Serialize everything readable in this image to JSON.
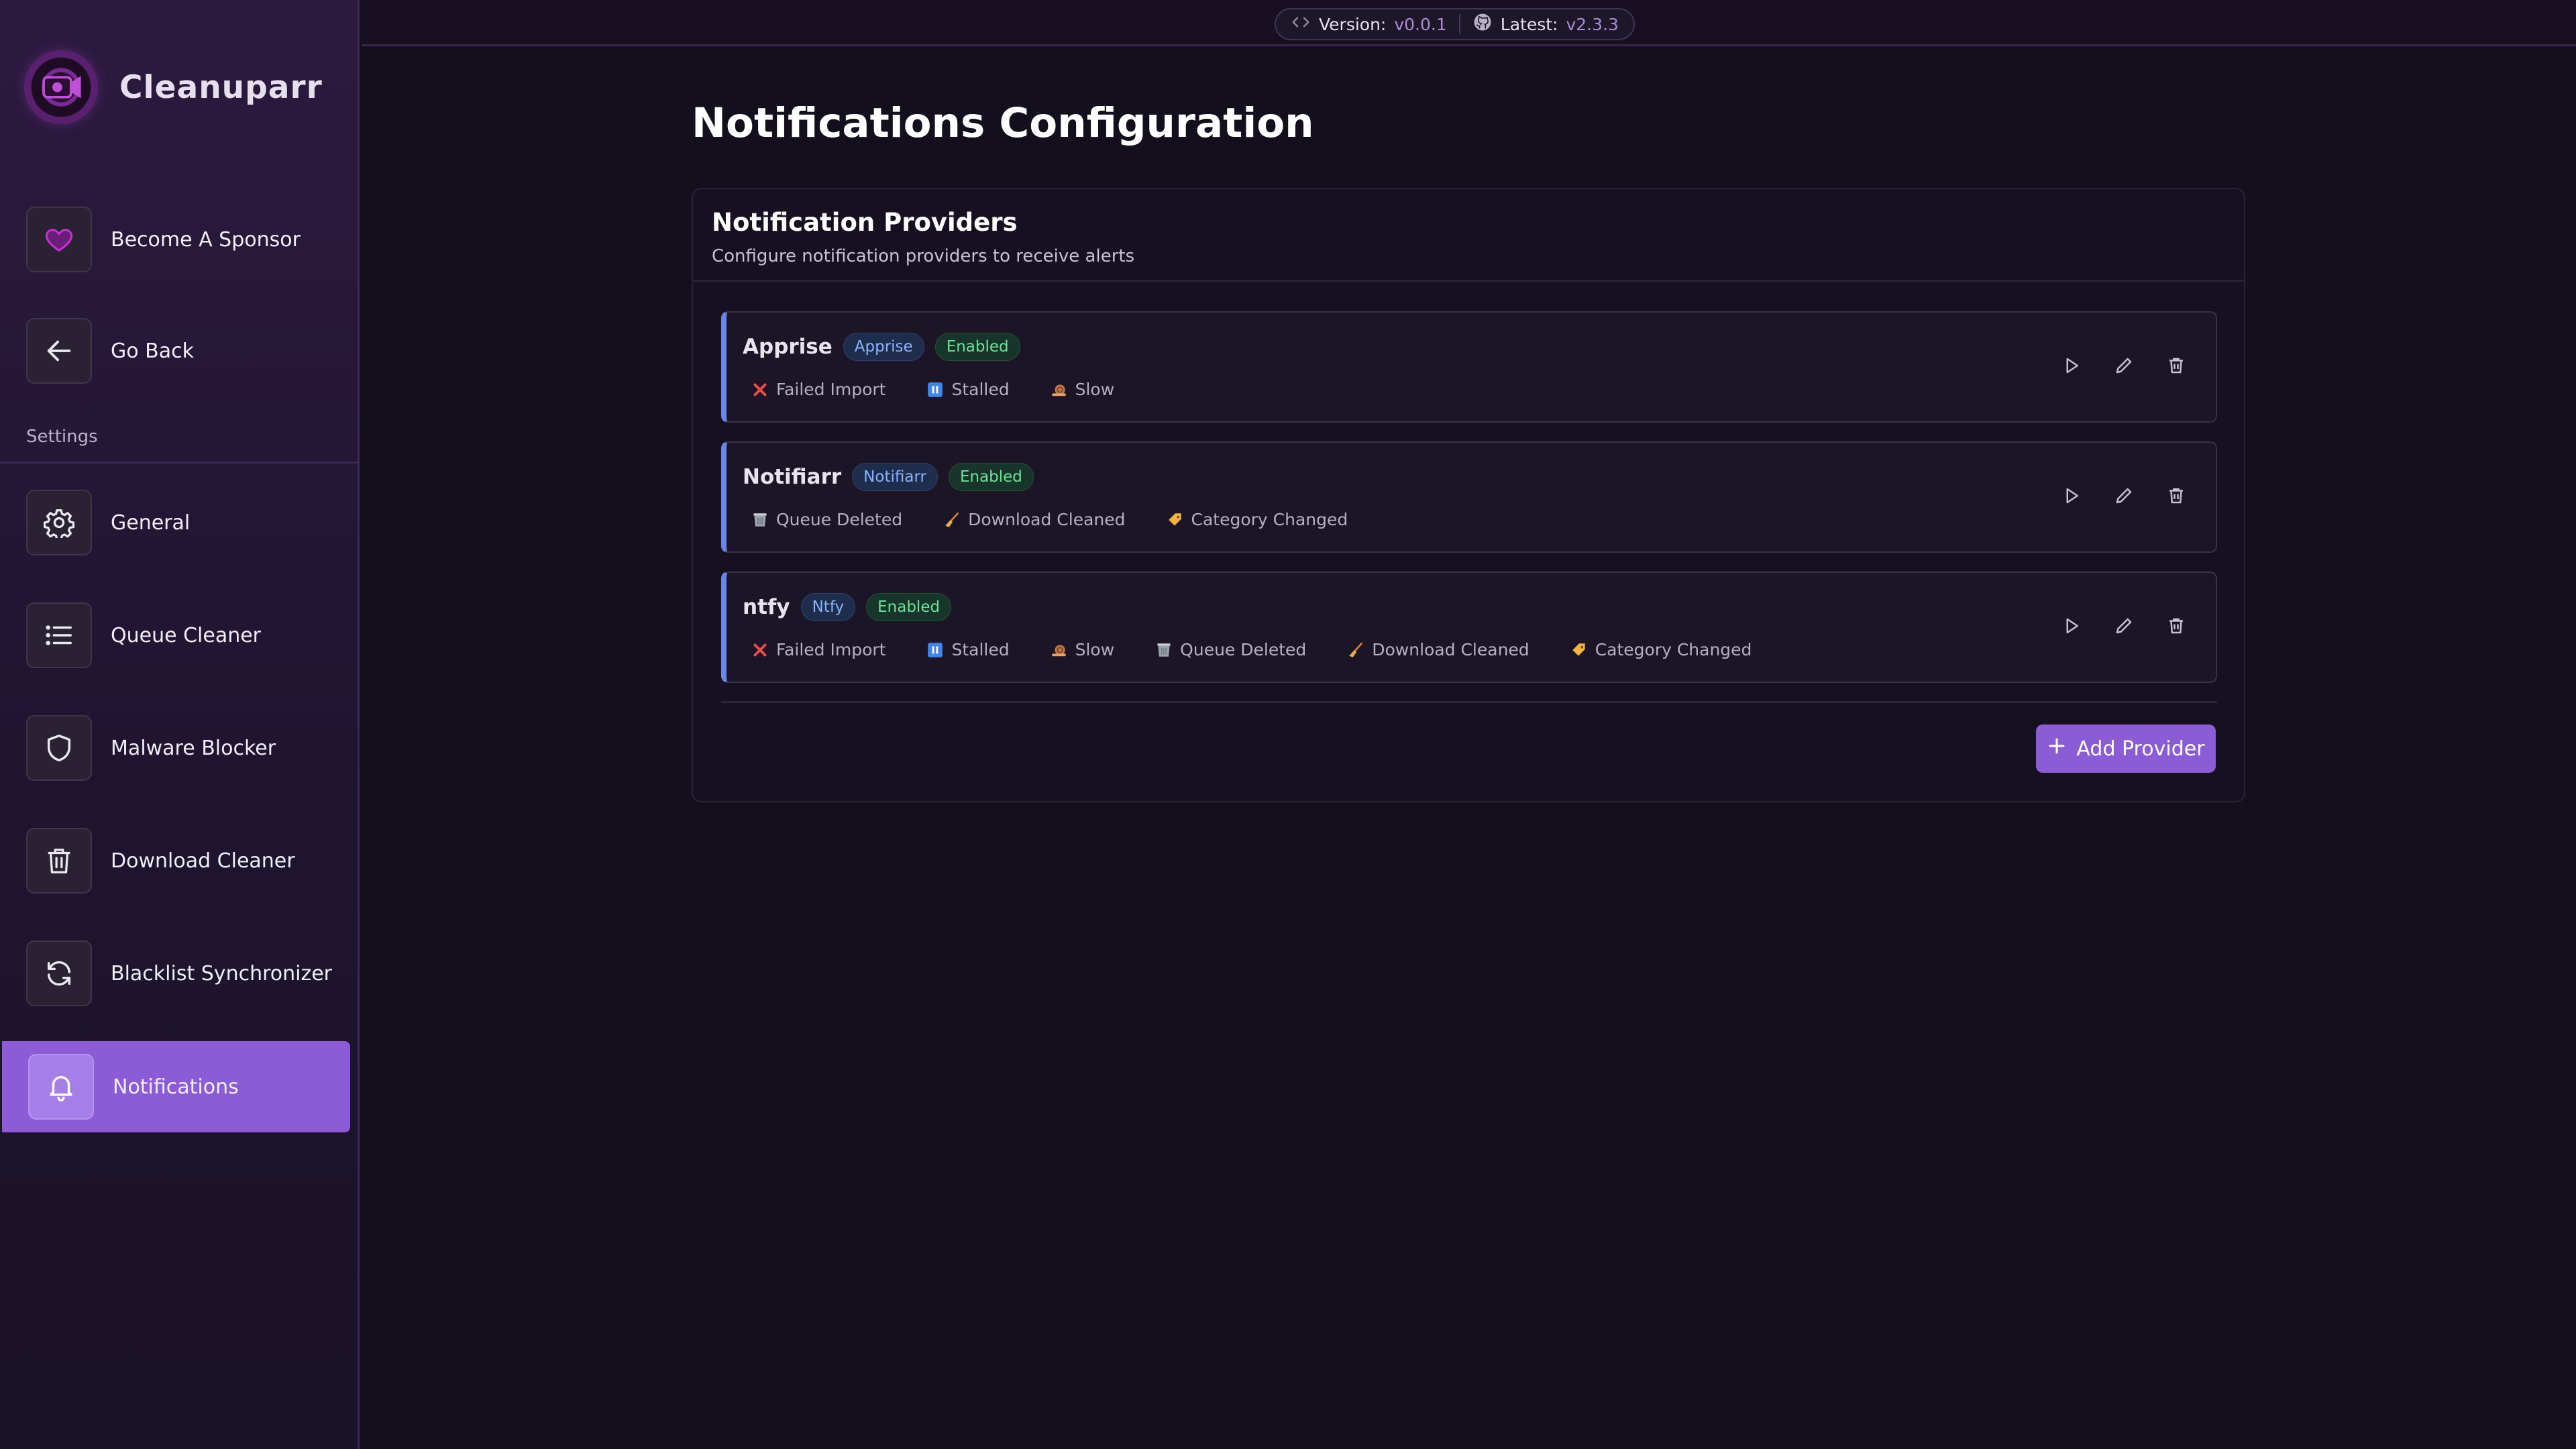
{
  "app": {
    "name": "Cleanuparr"
  },
  "topbar": {
    "version_label": "Version:",
    "version_value": "v0.0.1",
    "latest_label": "Latest:",
    "latest_value": "v2.3.3"
  },
  "sidebar": {
    "top_items": [
      {
        "label": "Become A Sponsor",
        "icon": "heart-icon"
      },
      {
        "label": "Go Back",
        "icon": "arrow-left-icon"
      }
    ],
    "section_label": "Settings",
    "items": [
      {
        "label": "General",
        "icon": "gear-icon"
      },
      {
        "label": "Queue Cleaner",
        "icon": "list-icon"
      },
      {
        "label": "Malware Blocker",
        "icon": "shield-icon"
      },
      {
        "label": "Download Cleaner",
        "icon": "trash-icon"
      },
      {
        "label": "Blacklist Synchronizer",
        "icon": "refresh-icon"
      },
      {
        "label": "Notifications",
        "icon": "bell-icon",
        "active": true
      }
    ]
  },
  "page": {
    "title": "Notifications Configuration"
  },
  "panel": {
    "title": "Notification Providers",
    "subtitle": "Configure notification providers to receive alerts",
    "add_button": "Add Provider"
  },
  "providers": [
    {
      "name": "Apprise",
      "type": "Apprise",
      "status": "Enabled",
      "events": [
        "Failed Import",
        "Stalled",
        "Slow"
      ]
    },
    {
      "name": "Notifiarr",
      "type": "Notifiarr",
      "status": "Enabled",
      "events": [
        "Queue Deleted",
        "Download Cleaned",
        "Category Changed"
      ]
    },
    {
      "name": "ntfy",
      "type": "Ntfy",
      "status": "Enabled",
      "events": [
        "Failed Import",
        "Stalled",
        "Slow",
        "Queue Deleted",
        "Download Cleaned",
        "Category Changed"
      ]
    }
  ],
  "colors": {
    "accent": "#8b5cd6",
    "provider_border": "#6b86e8",
    "enabled_text": "#6ee29b",
    "type_text": "#8ab2ff"
  }
}
